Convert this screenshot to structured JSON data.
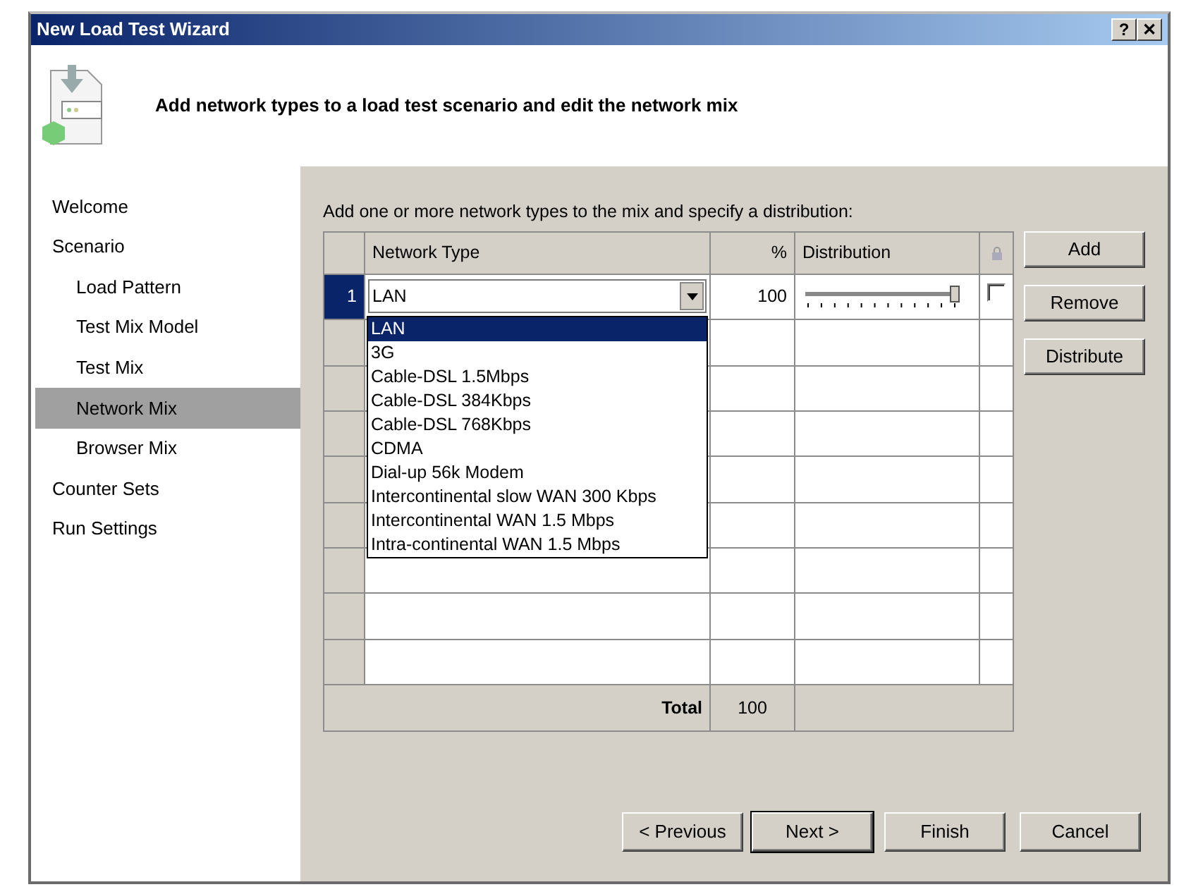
{
  "window": {
    "title": "New Load Test Wizard",
    "help_button": "?",
    "close_button": "✕"
  },
  "header": {
    "title": "Add network types to a load test scenario and edit the network mix"
  },
  "sidebar": {
    "items": [
      {
        "label": "Welcome",
        "selected": false
      },
      {
        "label": "Scenario",
        "selected": false,
        "children": [
          {
            "label": "Load Pattern",
            "selected": false
          },
          {
            "label": "Test Mix Model",
            "selected": false
          },
          {
            "label": "Test Mix",
            "selected": false
          },
          {
            "label": "Network Mix",
            "selected": true
          },
          {
            "label": "Browser Mix",
            "selected": false
          }
        ]
      },
      {
        "label": "Counter Sets",
        "selected": false
      },
      {
        "label": "Run Settings",
        "selected": false
      }
    ]
  },
  "instruction": "Add one or more network types to the mix and specify a distribution:",
  "grid": {
    "columns": [
      "Network Type",
      "%",
      "Distribution"
    ],
    "rows": [
      {
        "number": "1",
        "selected": true,
        "network_type": "LAN",
        "percent": "100",
        "level": 1,
        "locked": false
      }
    ],
    "total": {
      "label": "Total",
      "value": "100"
    }
  },
  "dropdown": {
    "options": [
      {
        "label": "LAN",
        "selected": true
      },
      {
        "label": "3G",
        "selected": false
      },
      {
        "label": "Cable-DSL 1.5Mbps",
        "selected": false
      },
      {
        "label": "Cable-DSL 384Kbps",
        "selected": false
      },
      {
        "label": "Cable-DSL 768Kbps",
        "selected": false
      },
      {
        "label": "CDMA",
        "selected": false
      },
      {
        "label": "Dial-up 56k Modem",
        "selected": false
      },
      {
        "label": "Intercontinental slow WAN 300 Kbps",
        "selected": false
      },
      {
        "label": "Intercontinental WAN 1.5 Mbps",
        "selected": false
      },
      {
        "label": "Intra-continental WAN 1.5 Mbps",
        "selected": false
      }
    ]
  },
  "side_buttons": [
    "Add",
    "Remove",
    "Distribute"
  ],
  "nav_buttons": [
    {
      "label": "< Previous",
      "default": false
    },
    {
      "label": "Next >",
      "default": true
    },
    {
      "label": "Finish",
      "default": false
    },
    {
      "label": "Cancel",
      "default": false
    }
  ]
}
